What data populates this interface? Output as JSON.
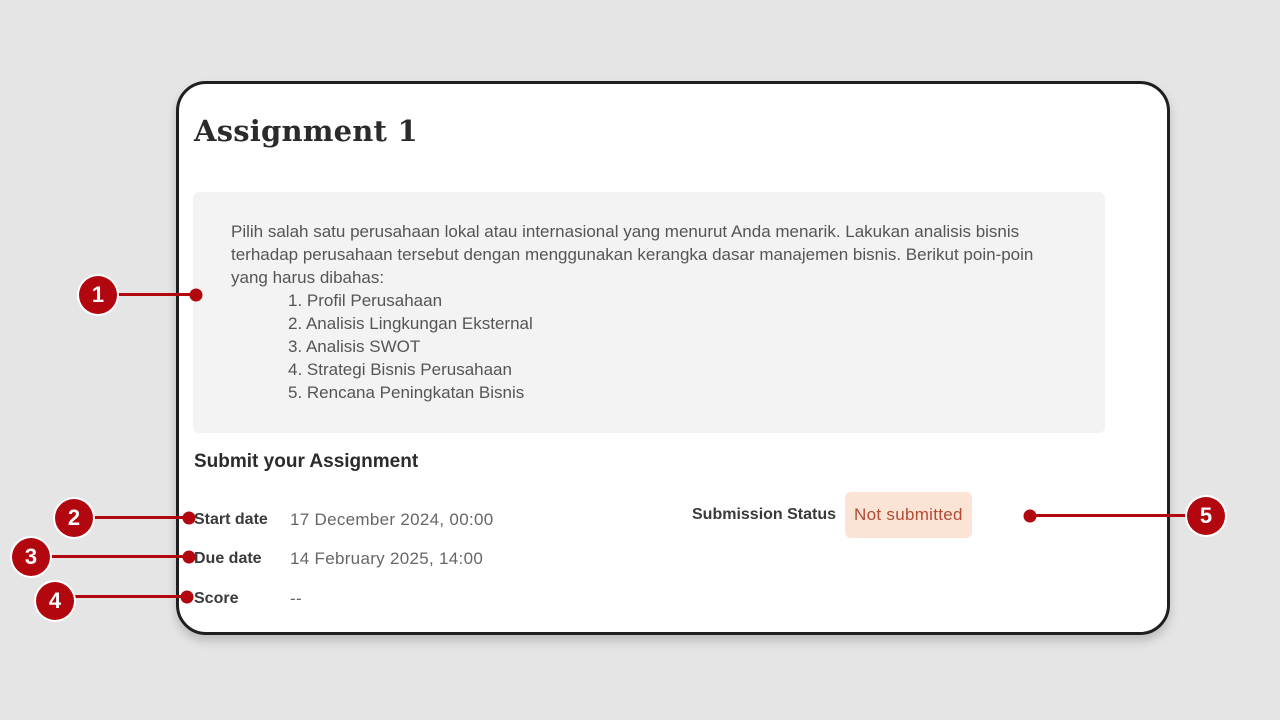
{
  "assignment": {
    "title": "Assignment 1",
    "description": "Pilih salah satu perusahaan lokal atau internasional yang menurut Anda menarik. Lakukan analisis bisnis terhadap perusahaan tersebut dengan menggunakan kerangka dasar manajemen bisnis. Berikut poin-poin yang harus dibahas:",
    "points": [
      "1. Profil Perusahaan",
      "2. Analisis Lingkungan Eksternal",
      "3. Analisis SWOT",
      "4. Strategi Bisnis Perusahaan",
      "5. Rencana Peningkatan Bisnis"
    ]
  },
  "submission": {
    "heading": "Submit your Assignment",
    "start_date_label": "Start date",
    "start_date_value": "17 December 2024, 00:00",
    "due_date_label": "Due date",
    "due_date_value": "14 February 2025, 14:00",
    "score_label": "Score",
    "score_value": "--",
    "status_label": "Submission Status",
    "status_value": "Not submitted"
  },
  "callouts": [
    "1",
    "2",
    "3",
    "4",
    "5"
  ],
  "colors": {
    "callout": "#b3070f",
    "status_badge_bg": "#fbe3d6",
    "status_badge_text": "#b34a33",
    "description_bg": "#f3f3f3",
    "page_bg": "#e5e5e5"
  }
}
